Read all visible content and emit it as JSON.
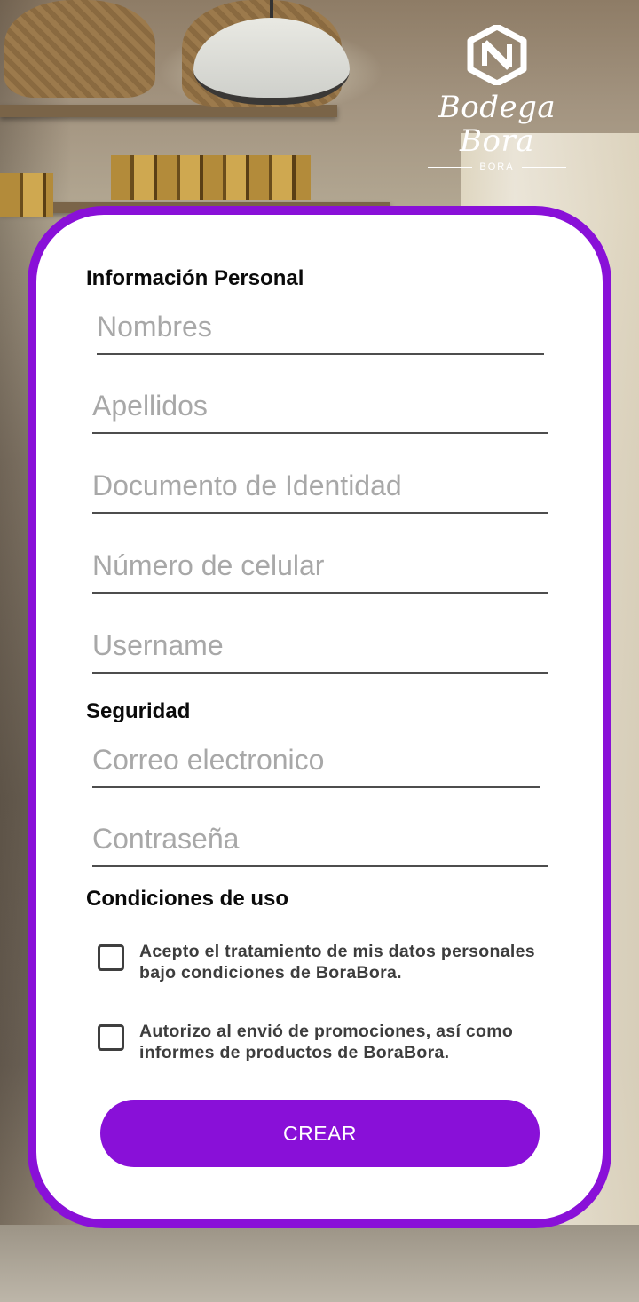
{
  "logo": {
    "wordmark": "Bodega Bora",
    "sub": "BORA"
  },
  "sections": {
    "personal": "Información Personal",
    "security": "Seguridad",
    "terms": "Condiciones de uso"
  },
  "fields": {
    "nombres": "Nombres",
    "apellidos": "Apellidos",
    "documento": "Documento de Identidad",
    "celular": "Número de celular",
    "username": "Username",
    "correo": "Correo electronico",
    "contrasena": "Contraseña"
  },
  "checks": {
    "datos": "Acepto el tratamiento de mis datos personales bajo condiciones de BoraBora.",
    "promociones": "Autorizo al envió de promociones, así como informes de productos de BoraBora."
  },
  "button": {
    "label": "CREAR"
  },
  "colors": {
    "accent": "#8910d8"
  }
}
